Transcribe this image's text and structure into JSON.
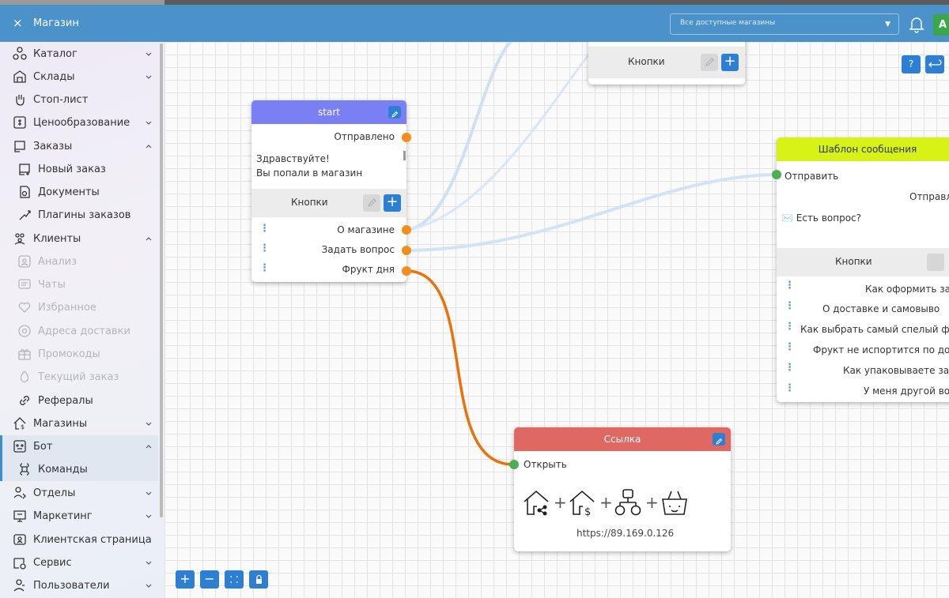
{
  "window": {
    "title": "Магазин",
    "close_label": "×"
  },
  "header": {
    "shop_select": {
      "value": "Все доступные магазины"
    },
    "avatar_letter": "A"
  },
  "sidebar": {
    "items": [
      {
        "label": "Каталог",
        "icon": "catalog-icon",
        "chevron": "down"
      },
      {
        "label": "Склады",
        "icon": "warehouse-icon",
        "chevron": "down"
      },
      {
        "label": "Стоп-лист",
        "icon": "hand-stop-icon"
      },
      {
        "label": "Ценообразование",
        "icon": "price-tag-icon",
        "chevron": "down"
      },
      {
        "label": "Заказы",
        "icon": "orders-icon",
        "chevron": "up"
      },
      {
        "label": "Новый заказ",
        "icon": "new-order-icon"
      },
      {
        "label": "Документы",
        "icon": "documents-icon"
      },
      {
        "label": "Плагины заказов",
        "icon": "plugins-icon"
      },
      {
        "label": "Клиенты",
        "icon": "clients-icon",
        "chevron": "up"
      },
      {
        "label": "Анализ",
        "icon": "analysis-icon"
      },
      {
        "label": "Чаты",
        "icon": "chat-icon"
      },
      {
        "label": "Избранное",
        "icon": "heart-icon"
      },
      {
        "label": "Адреса доставки",
        "icon": "location-icon"
      },
      {
        "label": "Промокоды",
        "icon": "gift-icon"
      },
      {
        "label": "Текущий заказ",
        "icon": "current-order-icon"
      },
      {
        "label": "Рефералы",
        "icon": "link-icon"
      },
      {
        "label": "Магазины",
        "icon": "shops-icon",
        "chevron": "down"
      },
      {
        "label": "Бот",
        "icon": "bot-icon",
        "chevron": "up"
      },
      {
        "label": "Команды",
        "icon": "command-icon"
      },
      {
        "label": "Отделы",
        "icon": "departments-icon",
        "chevron": "down"
      },
      {
        "label": "Маркетинг",
        "icon": "marketing-icon",
        "chevron": "down"
      },
      {
        "label": "Клиентская страница",
        "icon": "client-page-icon"
      },
      {
        "label": "Сервис",
        "icon": "service-icon",
        "chevron": "down"
      },
      {
        "label": "Пользователи",
        "icon": "users-icon",
        "chevron": "down"
      }
    ]
  },
  "canvas": {
    "top_node": {
      "buttons_label": "Кнопки"
    },
    "start_node": {
      "title": "start",
      "sent_label": "Отправлено",
      "message_line1": "Здравствуйте!",
      "message_line2": "Вы попали в магазин",
      "buttons_label": "Кнопки",
      "buttons": [
        "О магазине",
        "Задать вопрос",
        "Фрукт дня"
      ]
    },
    "template_node": {
      "title": "Шаблон сообщения",
      "send_label": "Отправить",
      "sent_label": "Отправле",
      "question_label": "✉️ Есть вопрос?",
      "buttons_label": "Кнопки",
      "buttons": [
        "Как оформить зака",
        "О доставке и самовыво",
        "Как выбрать самый спелый фру",
        "Фрукт не испортится по дорог",
        "Как упаковываете заказ",
        "У меня другой вопр"
      ]
    },
    "link_node": {
      "title": "Ссылка",
      "open_label": "Открыть",
      "plus": "+",
      "url": "https://89.169.0.126"
    },
    "top_right_controls": {
      "help": "?",
      "undo_icon": "undo-icon"
    },
    "bottom_controls": [
      "zoom-in-icon",
      "zoom-out-icon",
      "fit-icon",
      "lock-icon"
    ],
    "wire_colors": {
      "light": "#cfe0f3",
      "active": "#e8720c"
    },
    "header_colors": {
      "start": "#7b7ff4",
      "template": "#d6f216",
      "link": "#df6863"
    }
  }
}
